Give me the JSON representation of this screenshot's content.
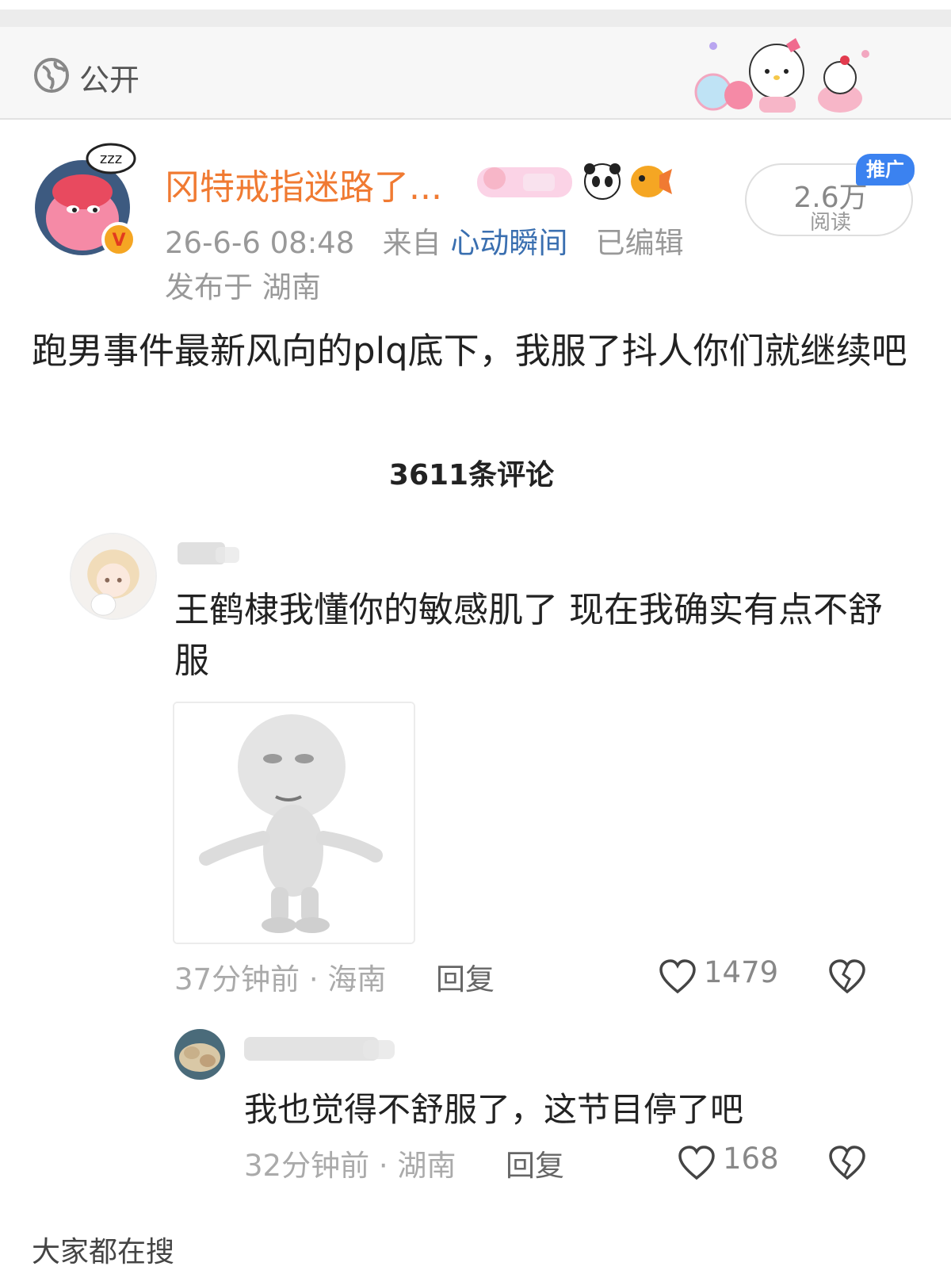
{
  "visibility": {
    "label": "公开",
    "icon": "globe-icon"
  },
  "post": {
    "author": "冈特戒指迷路了...",
    "verified_badge": "V",
    "date": "26-6-6 08:48",
    "from_prefix": "来自",
    "source": "心动瞬间",
    "edited": "已编辑",
    "location": "发布于 湖南",
    "views": "2.6万",
    "views_label": "阅读",
    "promo_badge": "推广",
    "text": "跑男事件最新风向的plq底下，我服了抖人你们就继续吧"
  },
  "comments_count": "3611条评论",
  "comments": [
    {
      "text": "王鹤棣我懂你的敏感肌了 现在我确实有点不舒服",
      "time_loc": "37分钟前 · 海南",
      "reply": "回复",
      "likes": "1479"
    },
    {
      "text": "我也觉得不舒服了，这节目停了吧",
      "time_loc": "32分钟前 · 湖南",
      "reply": "回复",
      "likes": "168"
    }
  ],
  "more_text": "大家都在搜",
  "colors": {
    "author": "#f07a32",
    "source_link": "#3a6fb0",
    "promo": "#3b82f0"
  }
}
